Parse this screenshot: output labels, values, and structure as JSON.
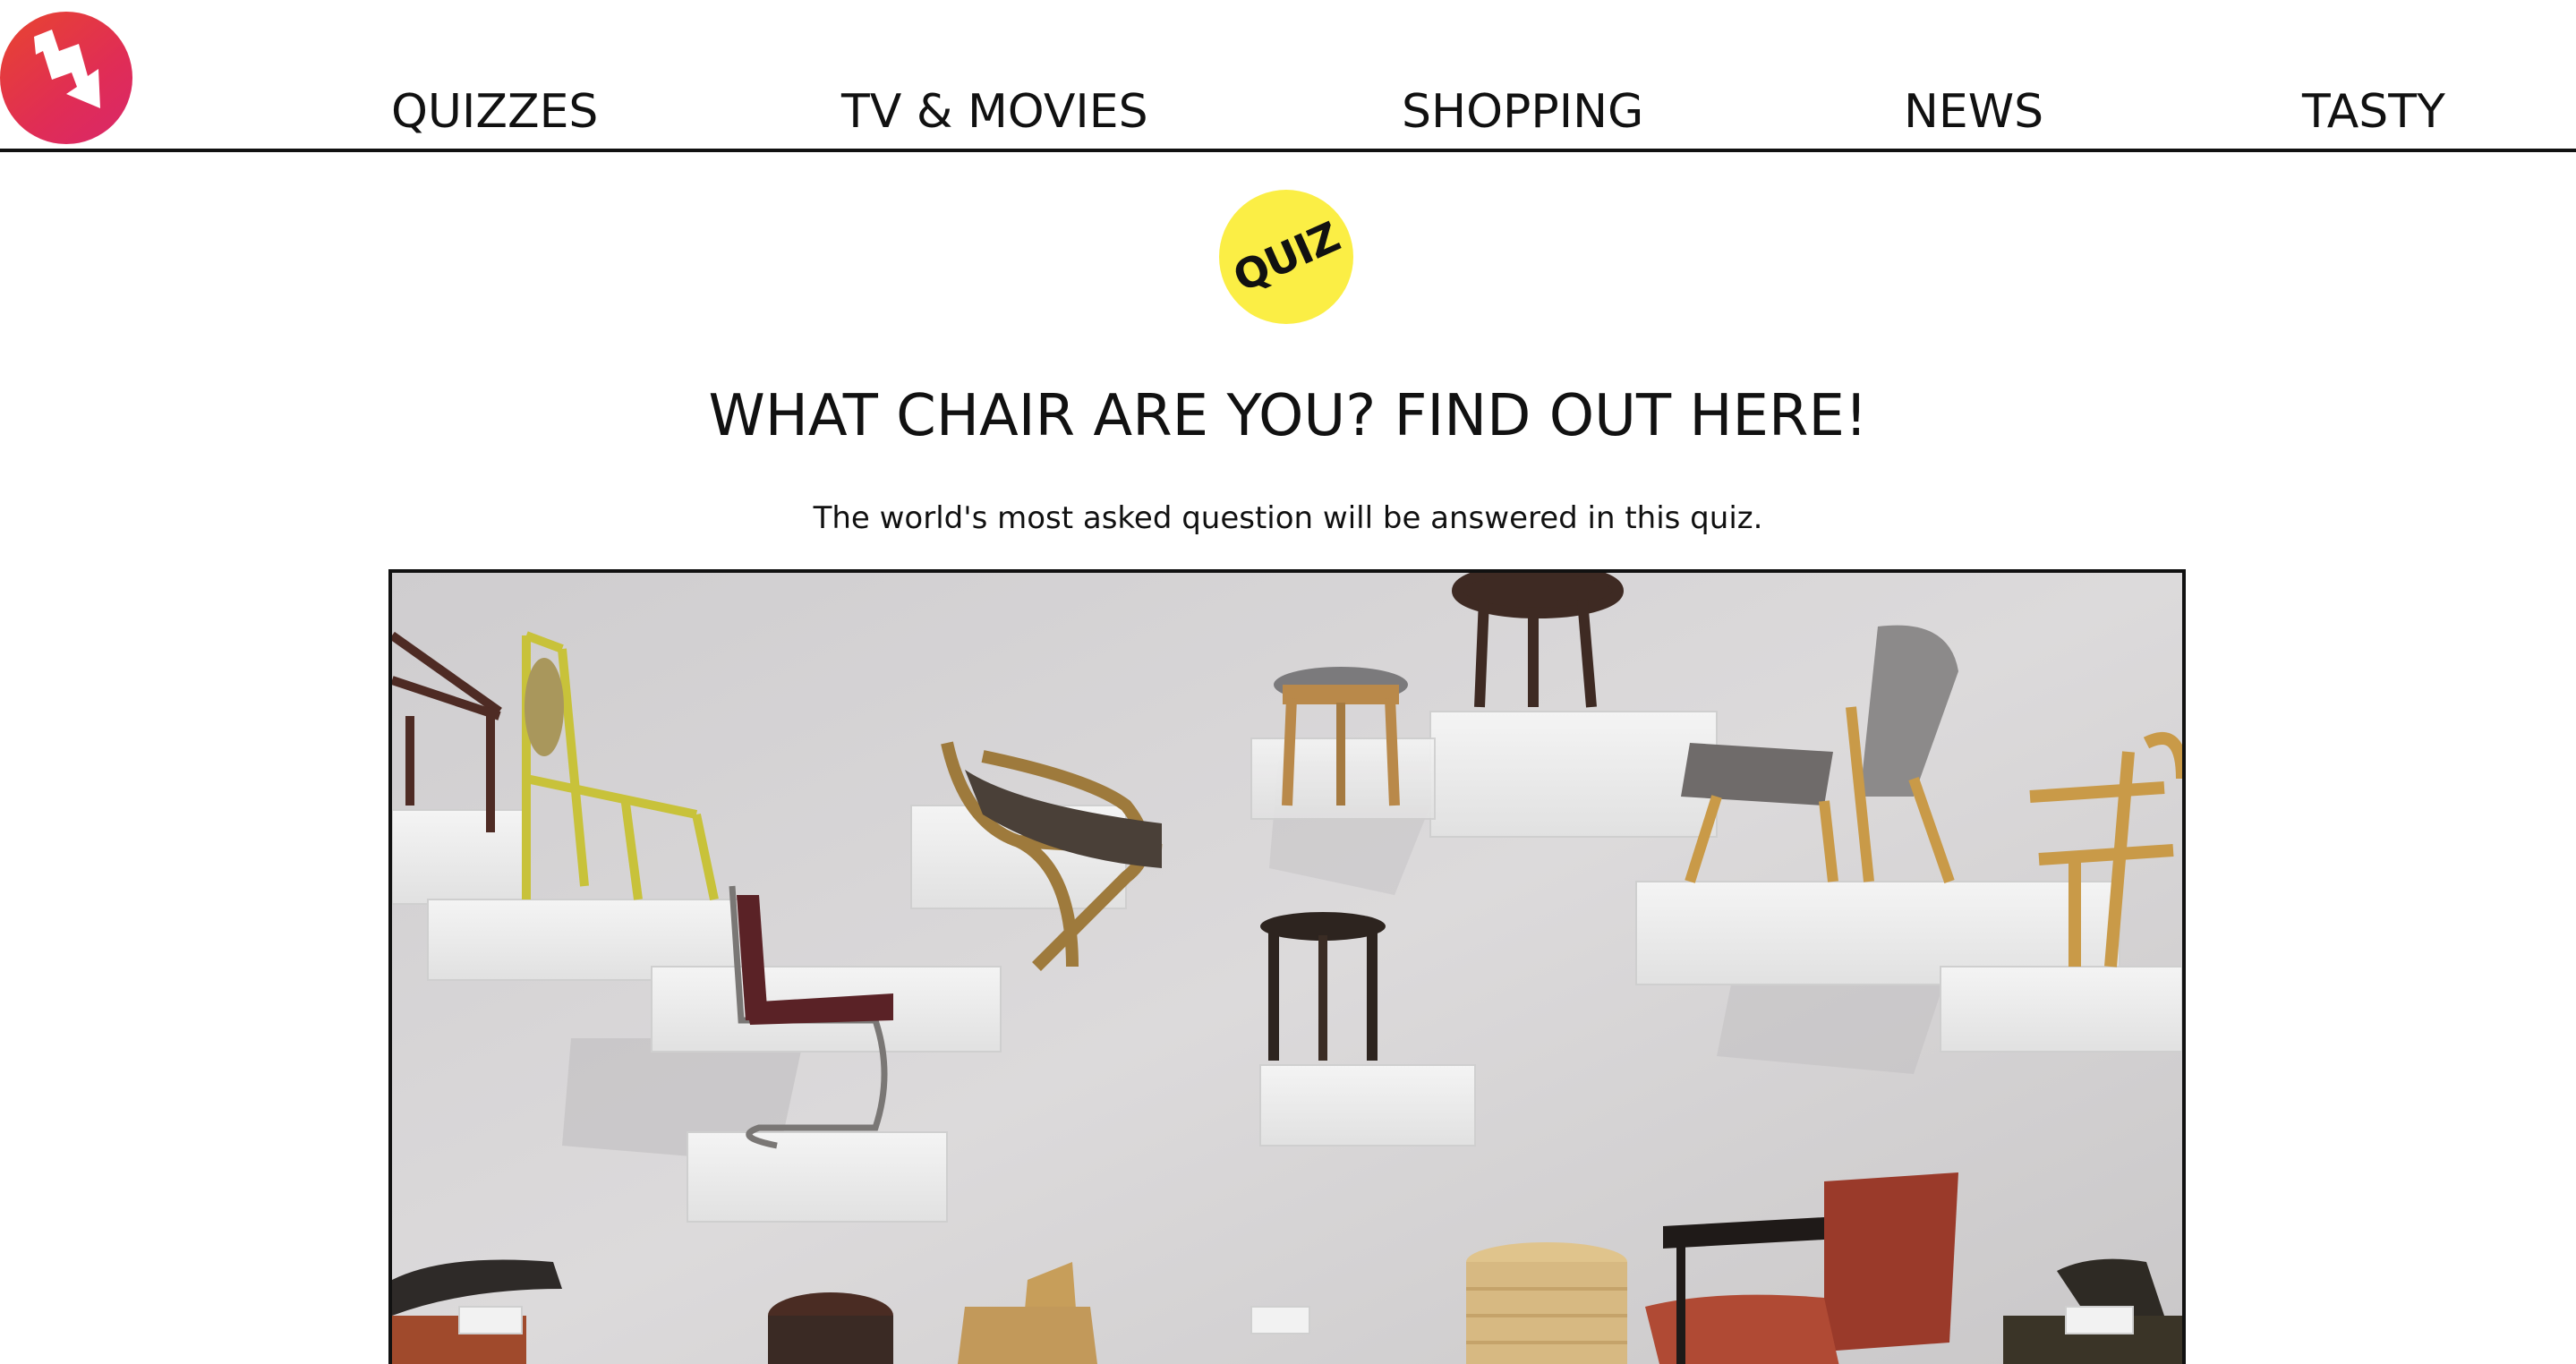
{
  "header": {
    "logo_icon": "trending-arrow-logo",
    "nav": [
      {
        "label": "QUIZZES"
      },
      {
        "label": "TV & MOVIES"
      },
      {
        "label": "SHOPPING"
      },
      {
        "label": "NEWS"
      },
      {
        "label": "TASTY"
      }
    ]
  },
  "badge": {
    "label": "QUIZ",
    "color": "#fbee45"
  },
  "quiz": {
    "title": "WHAT CHAIR ARE YOU? FIND OUT HERE!",
    "subtitle": "The world's most asked question will be answered in this quiz."
  },
  "hero_image": {
    "subject": "chairs-on-wall-shelves-photo"
  },
  "colors": {
    "brand": "#e32b4f",
    "text": "#111111",
    "background": "#ffffff",
    "badge": "#fbee45"
  }
}
